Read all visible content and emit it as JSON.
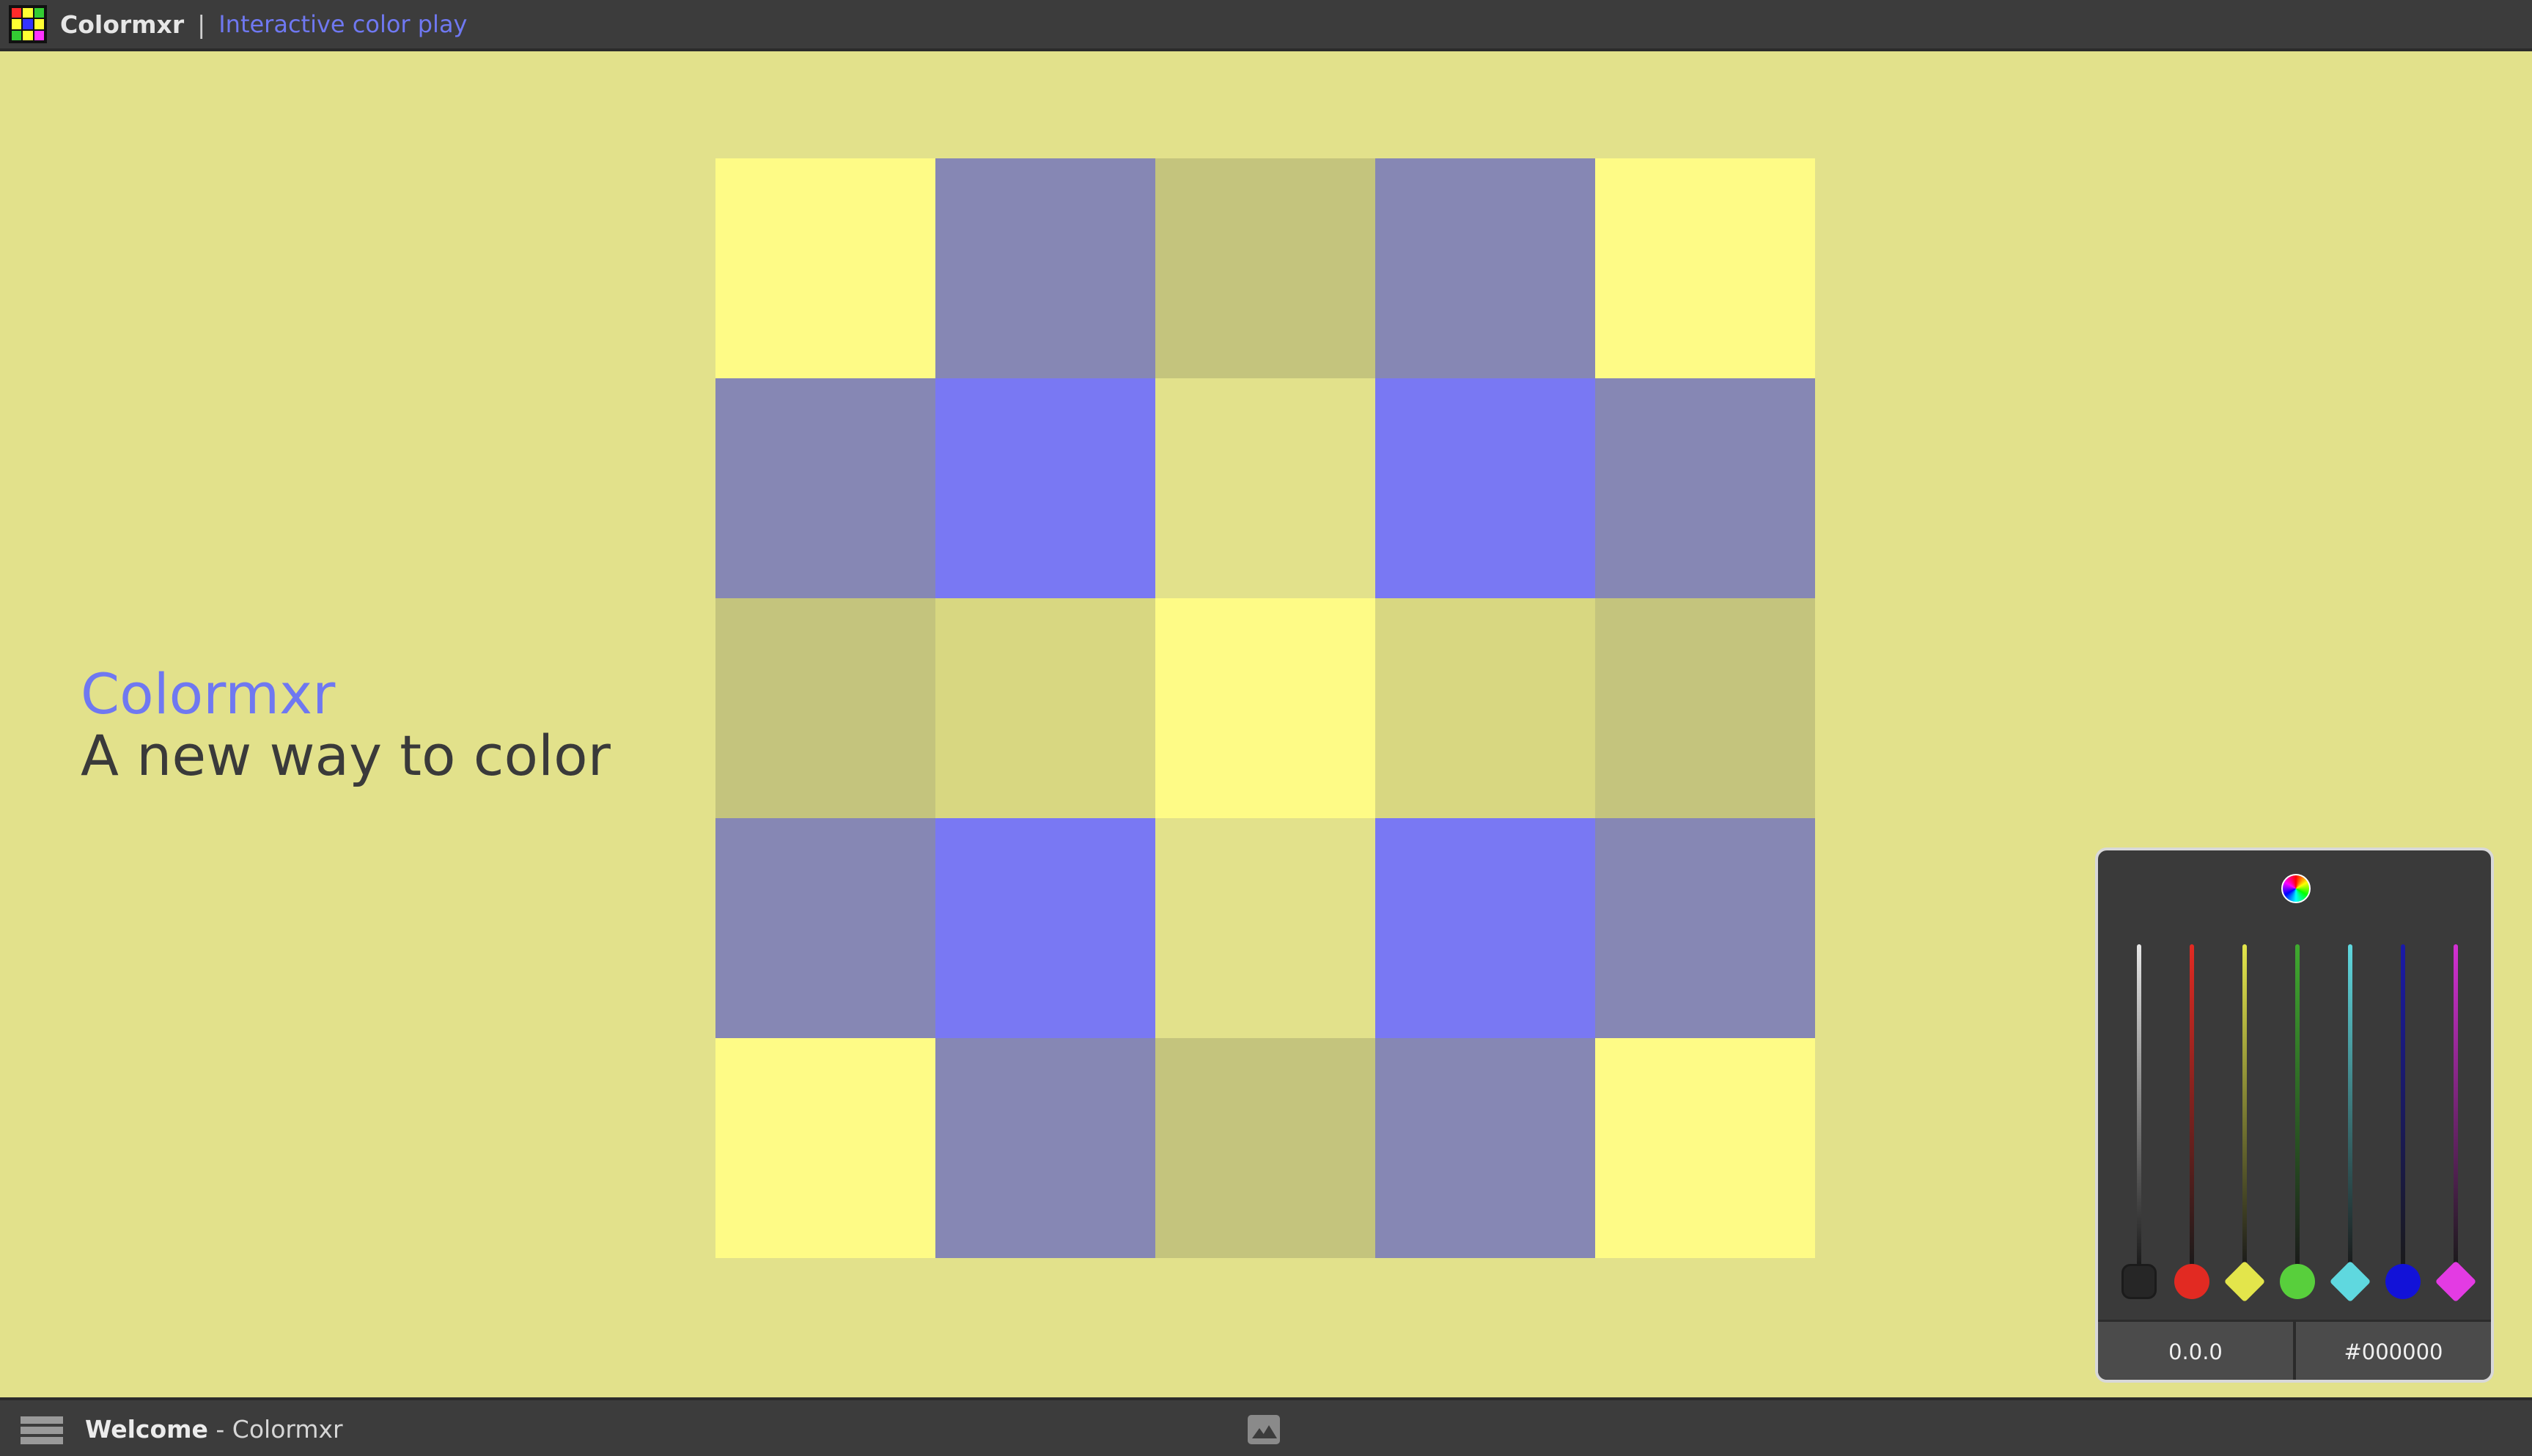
{
  "header": {
    "app_name": "Colormxr",
    "separator": "|",
    "tagline": "Interactive color play",
    "logo_icon": "color-grid-logo-icon",
    "logo_colors": [
      "#ff2a2a",
      "#ffff33",
      "#33cc33",
      "#ffff33",
      "#3333ff",
      "#ffff33",
      "#33cc33",
      "#ffff33",
      "#ff33ff"
    ]
  },
  "hero": {
    "title": "Colormxr",
    "subtitle": "A new way to color"
  },
  "palette": {
    "background": "#e2e18b",
    "accent": "#6f78f1",
    "bar": "#3c3c3c"
  },
  "color_grid": {
    "rows": [
      [
        "#fefb86",
        "#8687b4",
        "#c4c47d",
        "#8687b4",
        "#fefb86"
      ],
      [
        "#8687b4",
        "#7978f3",
        "#e2e18b",
        "#7978f3",
        "#8687b4"
      ],
      [
        "#c4c47d",
        "#d8d781",
        "#fefb86",
        "#d8d781",
        "#c4c47d"
      ],
      [
        "#8687b4",
        "#7978f3",
        "#e2e18b",
        "#7978f3",
        "#8687b4"
      ],
      [
        "#fefb86",
        "#8687b4",
        "#c4c47d",
        "#8687b4",
        "#fefb86"
      ]
    ]
  },
  "mixer": {
    "wheel_icon": "color-wheel-icon",
    "channels": [
      {
        "name": "white",
        "color": "#e6e6e6",
        "knob": "#262626",
        "shape": "square"
      },
      {
        "name": "red",
        "color": "#e22a22",
        "knob": "#e22a22",
        "shape": "round"
      },
      {
        "name": "yellow",
        "color": "#e3e54b",
        "knob": "#e3e54b",
        "shape": "diamond"
      },
      {
        "name": "green",
        "color": "#3faa2f",
        "knob": "#58cf3c",
        "shape": "round"
      },
      {
        "name": "cyan",
        "color": "#5fd8df",
        "knob": "#5fd8df",
        "shape": "diamond"
      },
      {
        "name": "blue",
        "color": "#1a1aa8",
        "knob": "#1212d8",
        "shape": "round"
      },
      {
        "name": "magenta",
        "color": "#d330d3",
        "knob": "#e33be3",
        "shape": "diamond"
      }
    ],
    "readout_value": "0.0.0",
    "readout_hex": "#000000"
  },
  "statusbar": {
    "menu_icon": "menu-icon",
    "page_label": "Welcome",
    "page_suffix": " - Colormxr",
    "image_icon": "image-icon"
  }
}
